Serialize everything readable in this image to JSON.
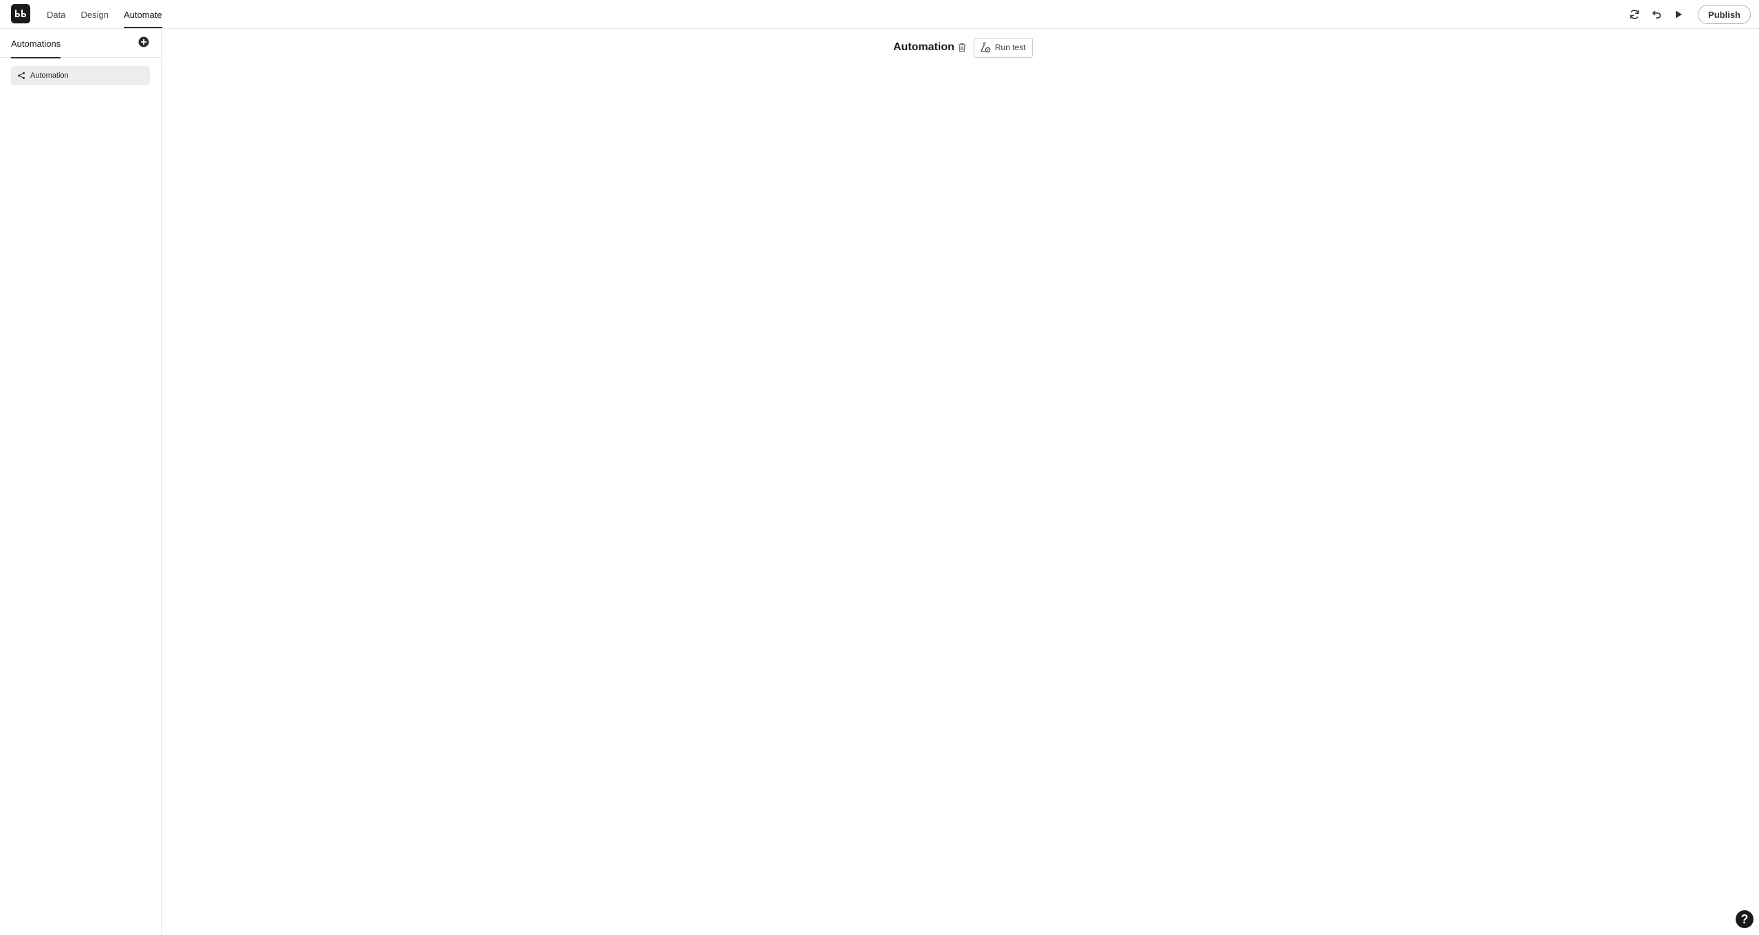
{
  "app": {
    "logo_text": "bb",
    "nav_tabs": [
      {
        "label": "Data"
      },
      {
        "label": "Design"
      },
      {
        "label": "Automate",
        "active": true
      }
    ],
    "actions": {
      "sync_icon": "sync-icon",
      "undo_icon": "undo-icon",
      "preview_icon": "play-icon",
      "publish_label": "Publish"
    }
  },
  "sidebar": {
    "tab_label": "Automations",
    "add_icon": "add-circle-icon",
    "items": [
      {
        "label": "Automation",
        "icon": "share-network-icon",
        "selected": true
      }
    ]
  },
  "canvas": {
    "title": "Automation",
    "delete_icon": "trash-icon",
    "run_test_label": "Run test",
    "help_glyph": "?"
  },
  "colors": {
    "accent": "#1a1a1a",
    "selected_item_bg": "#ededed",
    "border": "#e6e6e6"
  }
}
